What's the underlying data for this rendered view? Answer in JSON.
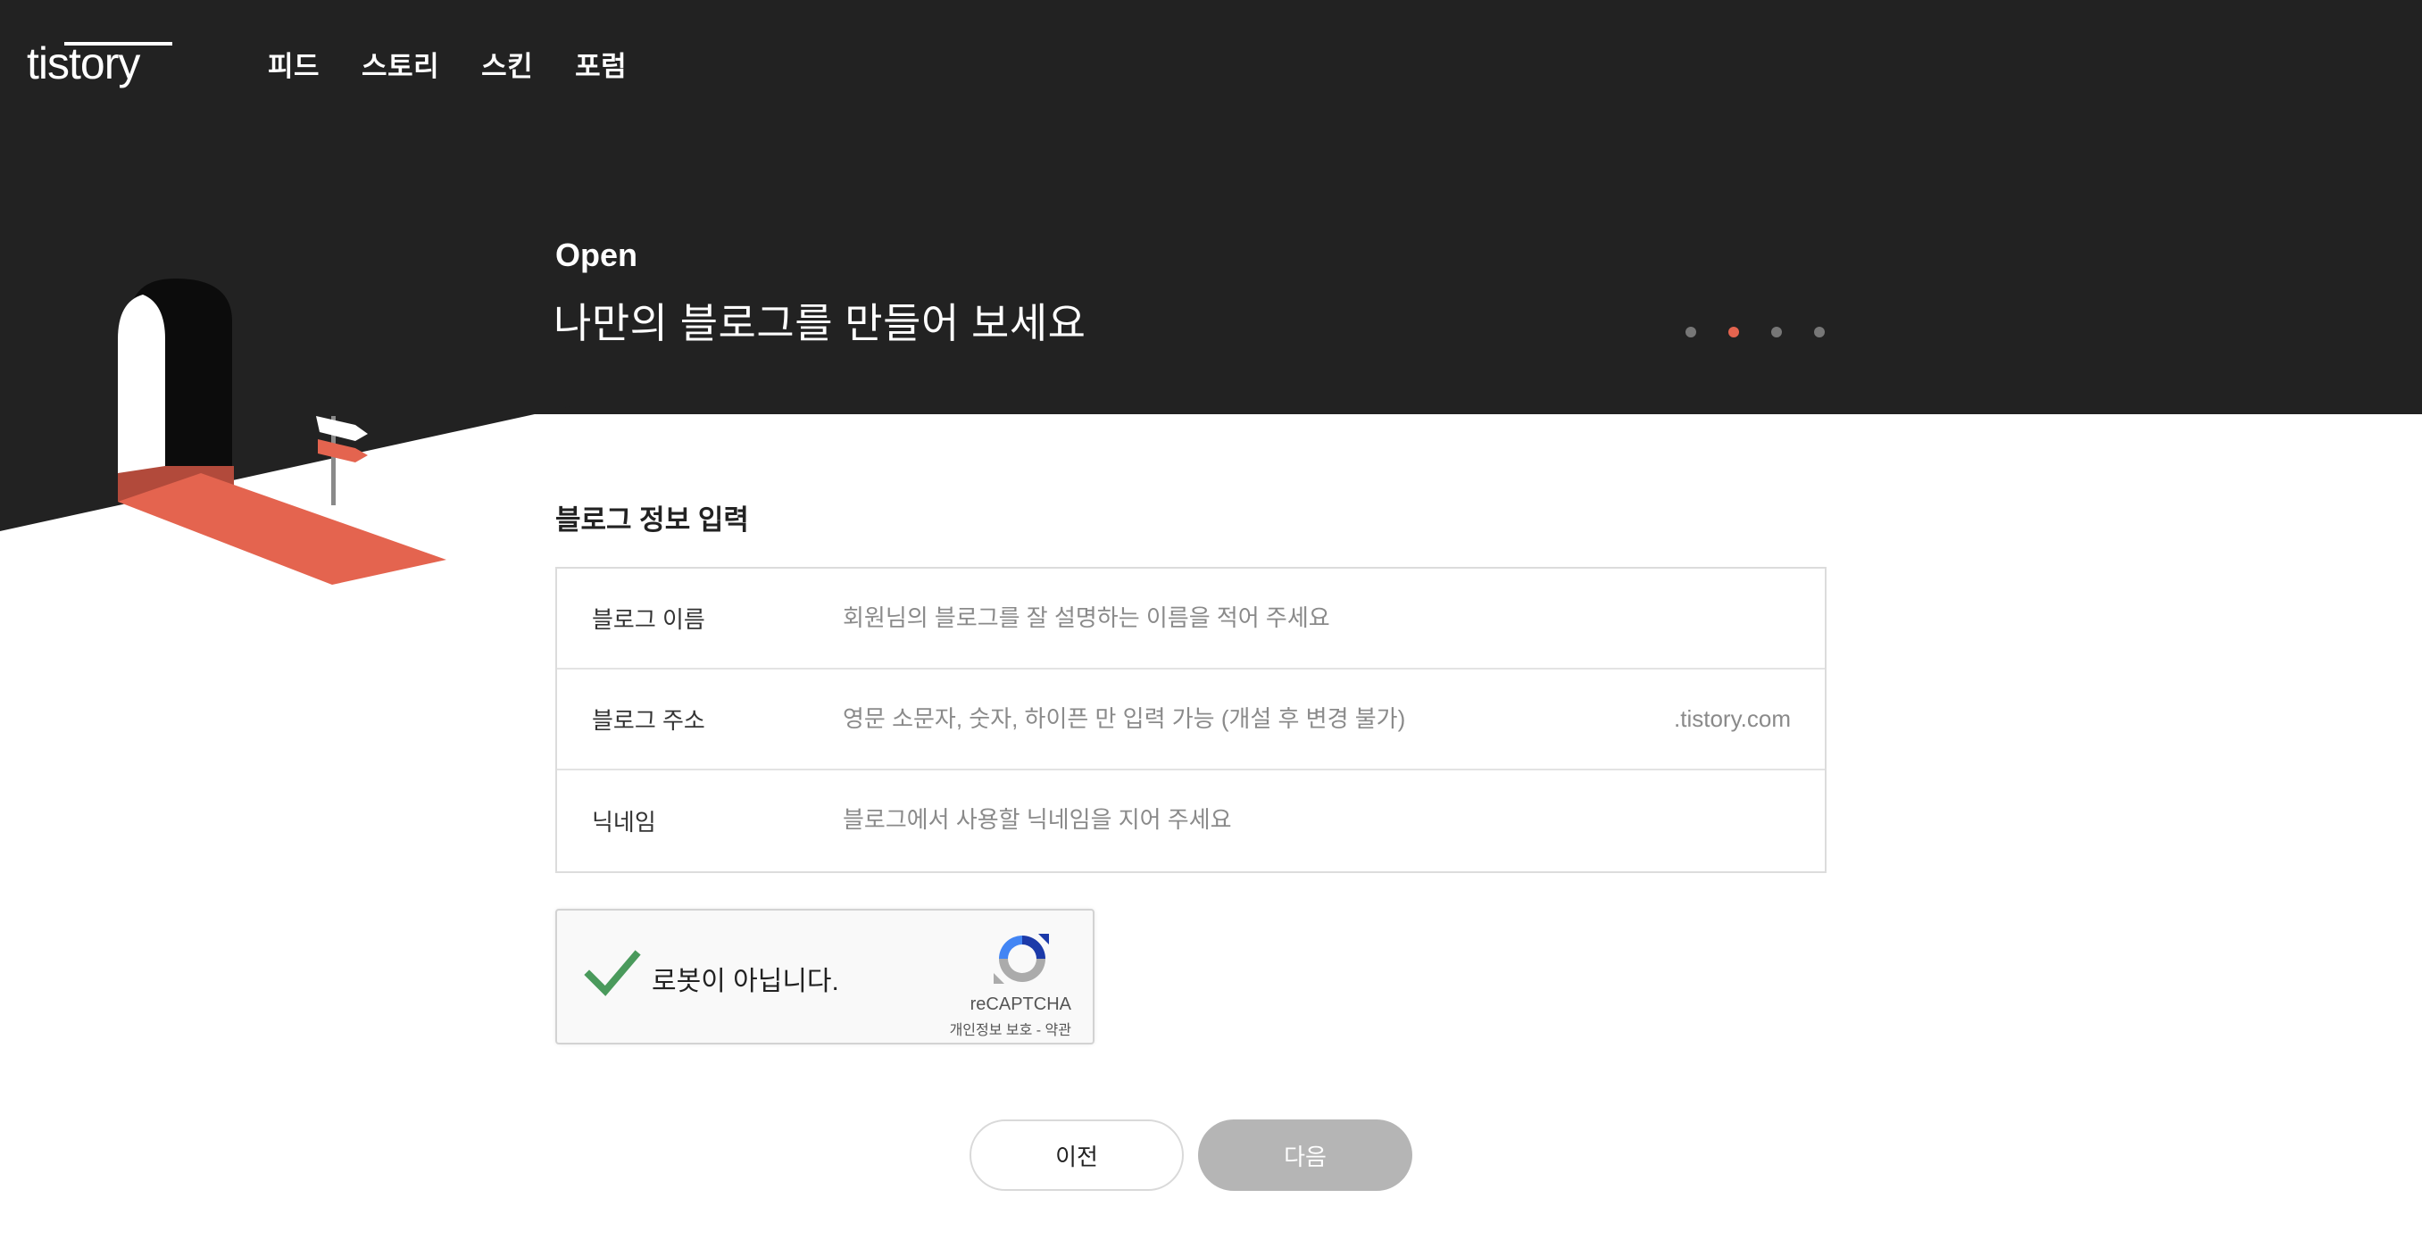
{
  "header": {
    "logo_text": "tistory",
    "nav": [
      {
        "label": "피드"
      },
      {
        "label": "스토리"
      },
      {
        "label": "스킨"
      },
      {
        "label": "포럼"
      }
    ]
  },
  "hero": {
    "eyebrow": "Open",
    "headline": "나만의 블로그를 만들어 보세요",
    "steps": {
      "total": 4,
      "active_index": 1
    }
  },
  "form": {
    "title": "블로그 정보 입력",
    "fields": [
      {
        "label": "블로그 이름",
        "value": "",
        "placeholder": "회원님의 블로그를 잘 설명하는 이름을 적어 주세요"
      },
      {
        "label": "블로그 주소",
        "value": "",
        "placeholder": "영문 소문자, 숫자, 하이픈 만 입력 가능 (개설 후 변경 불가)",
        "suffix": ".tistory.com"
      },
      {
        "label": "닉네임",
        "value": "",
        "placeholder": "블로그에서 사용할 닉네임을 지어 주세요"
      }
    ]
  },
  "captcha": {
    "checked": true,
    "label": "로봇이 아닙니다.",
    "brand": "reCAPTCHA",
    "privacy": "개인정보 보호",
    "separator": " - ",
    "terms": "약관"
  },
  "buttons": {
    "prev": "이전",
    "next": "다음"
  },
  "colors": {
    "header_bg": "#222222",
    "accent": "#e4644f",
    "next_disabled": "#b5b5b5",
    "check_green": "#4a9a5c"
  }
}
